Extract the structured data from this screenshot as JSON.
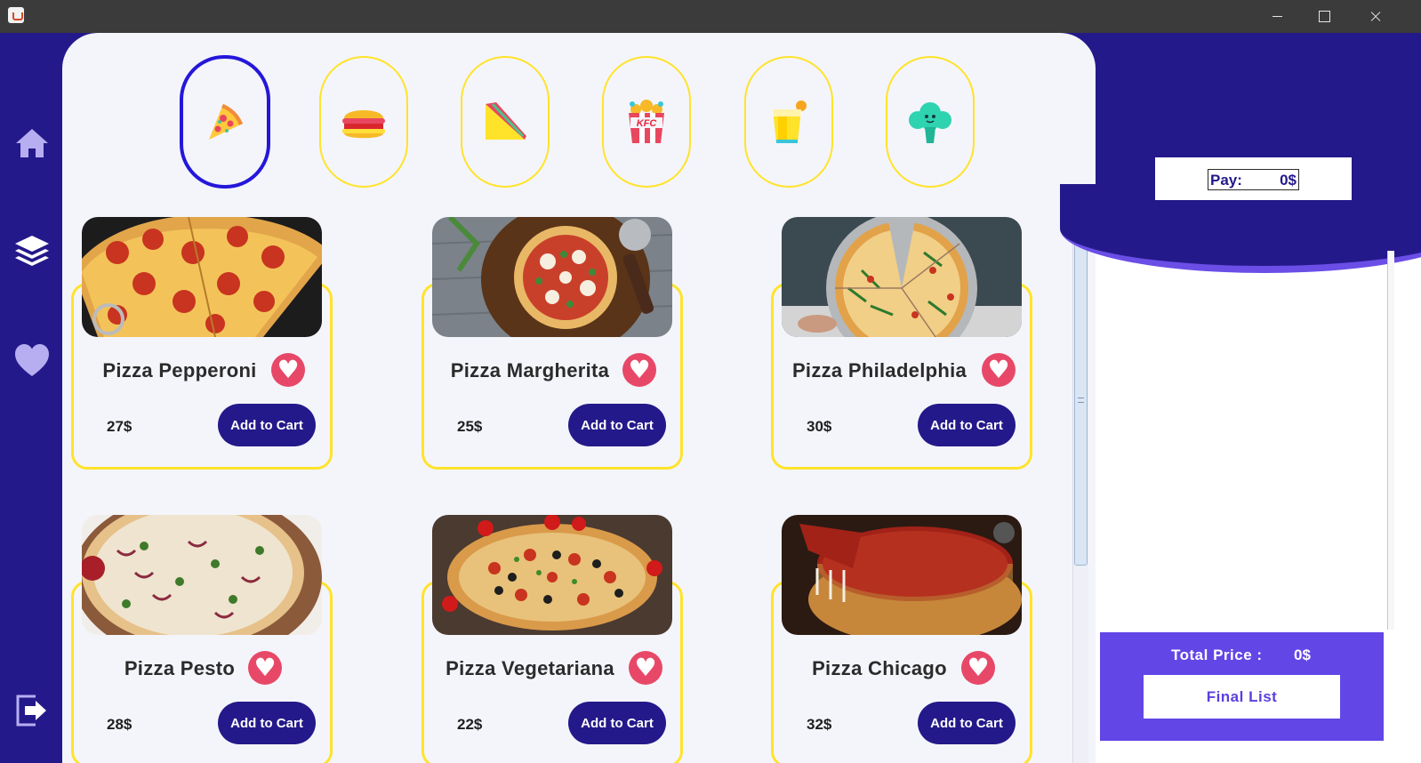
{
  "window": {
    "controls": [
      "minimize-icon",
      "maximize-icon",
      "close-icon"
    ]
  },
  "sidebar": {
    "items": [
      {
        "icon": "home-icon"
      },
      {
        "icon": "layers-icon"
      },
      {
        "icon": "heart-icon"
      },
      {
        "icon": "logout-icon"
      }
    ],
    "colors": {
      "background": "#24198a",
      "icon": "#b6aef0"
    }
  },
  "categories": [
    {
      "icon": "pizza-icon",
      "active": true
    },
    {
      "icon": "burger-icon",
      "active": false
    },
    {
      "icon": "sandwich-icon",
      "active": false
    },
    {
      "icon": "kfc-bucket-icon",
      "active": false
    },
    {
      "icon": "drink-icon",
      "active": false
    },
    {
      "icon": "broccoli-icon",
      "active": false
    }
  ],
  "products": [
    {
      "name": "Pizza Pepperoni",
      "price": "27$",
      "button": "Add to Cart"
    },
    {
      "name": "Pizza Margherita",
      "price": "25$",
      "button": "Add to Cart"
    },
    {
      "name": "Pizza Philadelphia",
      "price": "30$",
      "button": "Add to Cart"
    },
    {
      "name": "Pizza Pesto",
      "price": "28$",
      "button": "Add to Cart"
    },
    {
      "name": "Pizza Vegetariana",
      "price": "22$",
      "button": "Add to Cart"
    },
    {
      "name": "Pizza Chicago",
      "price": "32$",
      "button": "Add to Cart"
    }
  ],
  "cart": {
    "pay_label": "Pay:",
    "pay_value": "0$",
    "total_label": "Total Price :",
    "total_value": "0$",
    "final_button": "Final List"
  },
  "colors": {
    "primary": "#24198a",
    "accent": "#6246e6",
    "card_border": "#ffe32a",
    "active_border": "#2417d9",
    "heart": "#e84867"
  }
}
